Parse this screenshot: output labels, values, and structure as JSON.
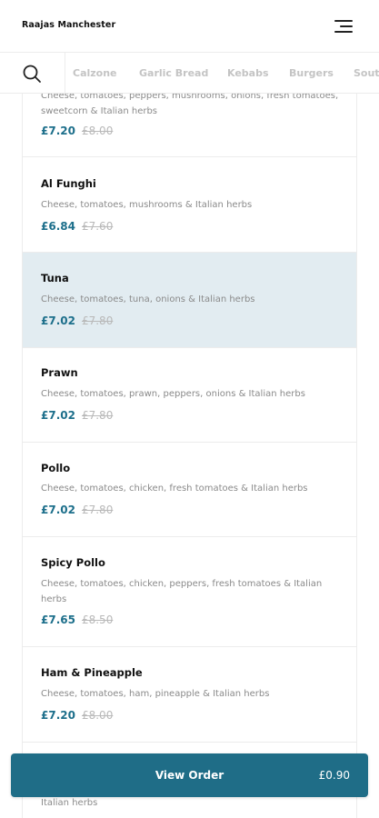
{
  "header": {
    "brand": "Raajas Manchester",
    "menu_icon": "hamburger-menu-icon"
  },
  "categories": {
    "search_icon": "search-icon",
    "items": [
      "Calzone",
      "Garlic Bread",
      "Kebabs",
      "Burgers",
      "Sout"
    ]
  },
  "menu_items": [
    {
      "name": "",
      "description": "Cheese, tomatoes, peppers, mushrooms, onions, fresh tomatoes, sweetcorn & Italian herbs",
      "price": "£7.20",
      "old_price": "£8.00",
      "active": false
    },
    {
      "name": "Al Funghi",
      "description": "Cheese, tomatoes, mushrooms & Italian herbs",
      "price": "£6.84",
      "old_price": "£7.60",
      "active": false
    },
    {
      "name": "Tuna",
      "description": "Cheese, tomatoes, tuna, onions & Italian herbs",
      "price": "£7.02",
      "old_price": "£7.80",
      "active": true
    },
    {
      "name": "Prawn",
      "description": "Cheese, tomatoes, prawn, peppers, onions & Italian herbs",
      "price": "£7.02",
      "old_price": "£7.80",
      "active": false
    },
    {
      "name": "Pollo",
      "description": "Cheese, tomatoes, chicken, fresh tomatoes & Italian herbs",
      "price": "£7.02",
      "old_price": "£7.80",
      "active": false
    },
    {
      "name": "Spicy Pollo",
      "description": "Cheese, tomatoes, chicken, peppers, fresh tomatoes & Italian herbs",
      "price": "£7.65",
      "old_price": "£8.50",
      "active": false
    },
    {
      "name": "Ham & Pineapple",
      "description": "Cheese, tomatoes, ham, pineapple & Italian herbs",
      "price": "£7.20",
      "old_price": "£8.00",
      "active": false
    },
    {
      "name": "",
      "description": "Italian herbs",
      "price": "",
      "old_price": "",
      "active": false
    }
  ],
  "view_order": {
    "label": "View Order",
    "total": "£0.90"
  },
  "colors": {
    "accent": "#1f6d87",
    "price": "#1d6f8b",
    "active_row": "#e2ecf1"
  }
}
